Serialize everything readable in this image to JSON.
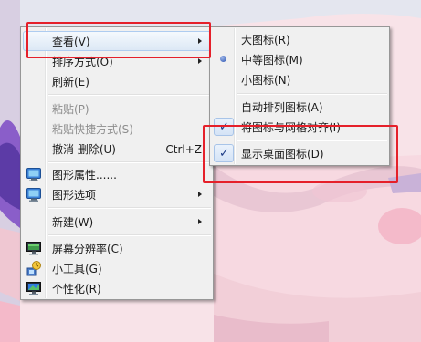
{
  "colors": {
    "menu_background": "#f0f0f0",
    "highlight_border": "#aeccf0",
    "annotation_red": "#e5202a",
    "check_mark_blue": "#1d3c86"
  },
  "context_menu": {
    "items": [
      {
        "label": "查看(V)",
        "has_submenu": true,
        "highlighted": true
      },
      {
        "label": "排序方式(O)",
        "has_submenu": true
      },
      {
        "label": "刷新(E)"
      },
      {
        "label": "粘贴(P)",
        "disabled": true
      },
      {
        "label": "粘贴快捷方式(S)",
        "disabled": true
      },
      {
        "label": "撤消 删除(U)",
        "shortcut": "Ctrl+Z"
      },
      {
        "label": "图形属性......",
        "icon": "graphics-properties-icon"
      },
      {
        "label": "图形选项",
        "icon": "graphics-options-icon",
        "has_submenu": true
      },
      {
        "label": "新建(W)",
        "has_submenu": true
      },
      {
        "label": "屏幕分辨率(C)",
        "icon": "screen-resolution-icon"
      },
      {
        "label": "小工具(G)",
        "icon": "gadgets-icon"
      },
      {
        "label": "个性化(R)",
        "icon": "personalize-icon"
      }
    ]
  },
  "view_submenu": {
    "items": [
      {
        "label": "大图标(R)"
      },
      {
        "label": "中等图标(M)",
        "selected": true,
        "marker": "radio-dot"
      },
      {
        "label": "小图标(N)"
      },
      {
        "label": "自动排列图标(A)",
        "checked": false
      },
      {
        "label": "将图标与网格对齐(I)",
        "checked": true,
        "marker": "check-mark"
      },
      {
        "label": "显示桌面图标(D)",
        "checked": true,
        "marker": "check-mark"
      }
    ],
    "check_glyph": "✓"
  },
  "annotations": [
    "red-box-view-item",
    "red-box-show-desktop-icons"
  ]
}
